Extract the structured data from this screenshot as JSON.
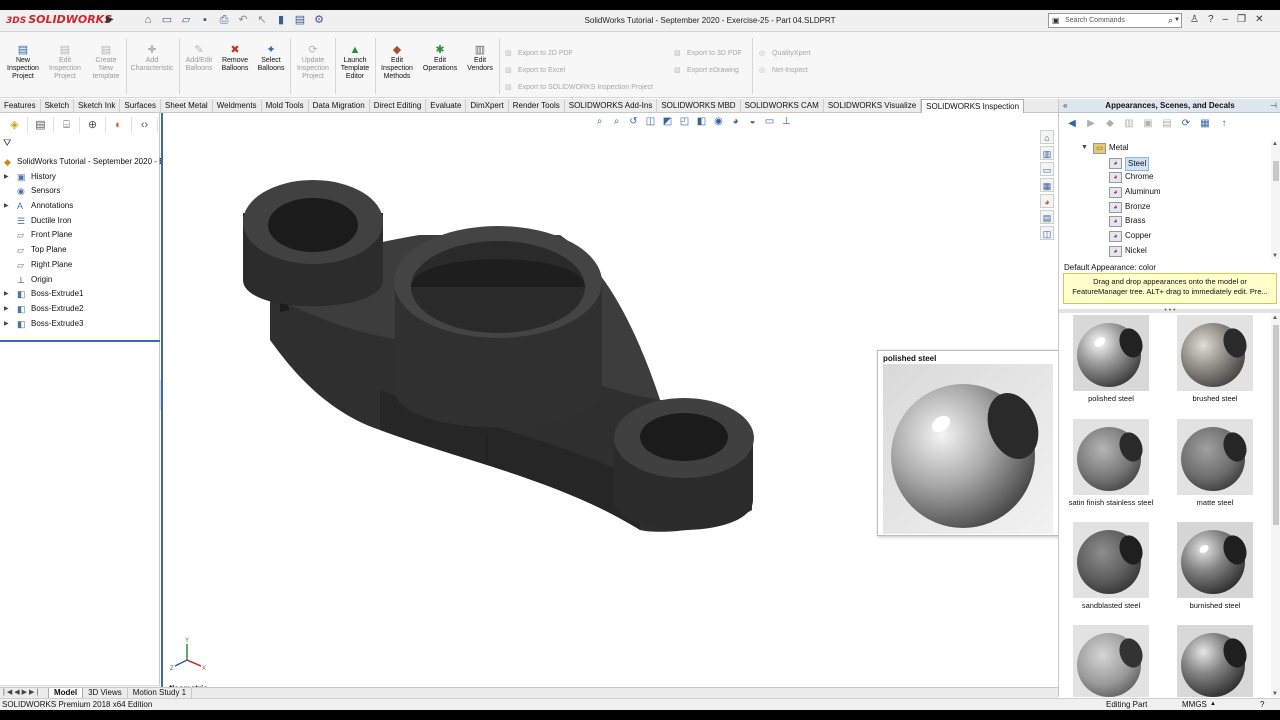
{
  "window": {
    "title": "SolidWorks Tutorial - September 2020 - Exercise-25 - Part 04.SLDPRT",
    "logo": "SOLIDWORKS",
    "search_placeholder": "Search Commands",
    "help_icon": "?"
  },
  "ribbon": {
    "new_inspection": "New Inspection Project",
    "edit_inspection": "Edit Inspection Project",
    "create_template": "Create New template",
    "add_characteristic": "Add Characteristic",
    "add_edit_balloons": "Add/Edit Balloons",
    "remove_balloons": "Remove Balloons",
    "select_balloons": "Select Balloons",
    "update_inspection": "Update Inspection Project",
    "launch_template": "Launch Template Editor",
    "edit_methods": "Edit Inspection Methods",
    "edit_operations": "Edit Operations",
    "edit_vendors": "Edit Vendors",
    "export_2d_pdf": "Export to 2D PDF",
    "export_excel": "Export to Excel",
    "export_inspection": "Export to SOLIDWORKS Inspection Project",
    "export_3d_pdf": "Export to 3D PDF",
    "export_edrawing": "Export eDrawing",
    "qualityxpert": "QualityXpert",
    "net_inspect": "Net-Inspect"
  },
  "tabs": [
    "Features",
    "Sketch",
    "Sketch Ink",
    "Surfaces",
    "Sheet Metal",
    "Weldments",
    "Mold Tools",
    "Data Migration",
    "Direct Editing",
    "Evaluate",
    "DimXpert",
    "Render Tools",
    "SOLIDWORKS Add-Ins",
    "SOLIDWORKS MBD",
    "SOLIDWORKS CAM",
    "SOLIDWORKS Visualize",
    "SOLIDWORKS Inspection"
  ],
  "active_tab": "SOLIDWORKS Inspection",
  "feature_tree": {
    "root": "SolidWorks Tutorial - September 2020 - E",
    "items": [
      {
        "label": "History",
        "icon": "history-icon",
        "expandable": true
      },
      {
        "label": "Sensors",
        "icon": "sensor-icon",
        "expandable": false
      },
      {
        "label": "Annotations",
        "icon": "annotation-icon",
        "expandable": true
      },
      {
        "label": "Ductile Iron",
        "icon": "material-icon",
        "expandable": false
      },
      {
        "label": "Front Plane",
        "icon": "plane-icon",
        "expandable": false
      },
      {
        "label": "Top Plane",
        "icon": "plane-icon",
        "expandable": false
      },
      {
        "label": "Right Plane",
        "icon": "plane-icon",
        "expandable": false
      },
      {
        "label": "Origin",
        "icon": "origin-icon",
        "expandable": false
      },
      {
        "label": "Boss-Extrude1",
        "icon": "extrude-icon",
        "expandable": true
      },
      {
        "label": "Boss-Extrude2",
        "icon": "extrude-icon",
        "expandable": true
      },
      {
        "label": "Boss-Extrude3",
        "icon": "extrude-icon",
        "expandable": true
      }
    ]
  },
  "viewport": {
    "view_label": "*Isometric",
    "model_color": "#3a3a3a"
  },
  "preview": {
    "title": "polished steel"
  },
  "task_pane": {
    "title": "Appearances, Scenes, and Decals",
    "folder": "Metal",
    "materials": [
      "Steel",
      "Chrome",
      "Aluminum",
      "Bronze",
      "Brass",
      "Copper",
      "Nickel"
    ],
    "selected": "Steel",
    "default_appearance": "Default Appearance: color",
    "hint": "Drag and drop appearances onto the model or FeatureManager tree.  ALT+ drag to immediately edit.  Pre...",
    "swatches": [
      {
        "label": "polished steel",
        "style": "polished"
      },
      {
        "label": "brushed steel",
        "style": "brushed"
      },
      {
        "label": "satin finish stainless steel",
        "style": "satin"
      },
      {
        "label": "matte steel",
        "style": "matte"
      },
      {
        "label": "sandblasted steel",
        "style": "sandblasted"
      },
      {
        "label": "burnished steel",
        "style": "burnished"
      },
      {
        "label": "",
        "style": "textured"
      },
      {
        "label": "",
        "style": "polished2"
      }
    ]
  },
  "bottom_tabs": [
    "Model",
    "3D Views",
    "Motion Study 1"
  ],
  "active_bottom_tab": "Model",
  "status": {
    "left": "SOLIDWORKS Premium 2018 x64 Edition",
    "mode": "Editing Part",
    "units": "MMGS"
  },
  "colors": {
    "brand_red": "#d0262c",
    "accent_blue": "#3b6aa6",
    "hint_yellow": "#ffffcc"
  }
}
